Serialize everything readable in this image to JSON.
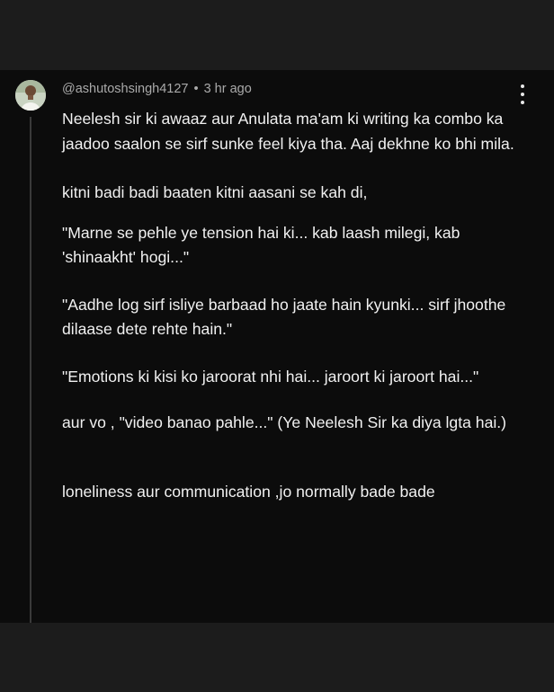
{
  "comment": {
    "author": "@ashutoshsingh4127",
    "separator": "•",
    "timestamp": "3 hr ago",
    "paragraphs": [
      "Neelesh sir ki awaaz aur Anulata ma'am ki writing ka combo ka jaadoo saalon se sirf sunke feel kiya tha. Aaj dekhne ko bhi mila.",
      "kitni badi badi baaten kitni aasani se kah di,",
      "\"Marne se pehle ye tension hai ki... kab laash milegi, kab 'shinaakht' hogi...\"",
      "\"Aadhe log sirf isliye barbaad ho jaate hain kyunki... sirf jhoothe dilaase dete rehte hain.\"",
      "\"Emotions ki kisi ko jaroorat nhi hai... jaroort ki jaroort hai...\"",
      "aur vo , \"video banao pahle...\" (Ye Neelesh Sir ka diya lgta hai.)",
      "loneliness aur communication ,jo normally bade bade"
    ],
    "icons": {
      "avatar": "avatar",
      "more": "more-vertical-icon"
    }
  },
  "colors": {
    "card_background": "#0c0c0c",
    "page_background": "#1b1b1b",
    "text": "#f1f1f1",
    "meta_text": "#aaaaaa"
  }
}
